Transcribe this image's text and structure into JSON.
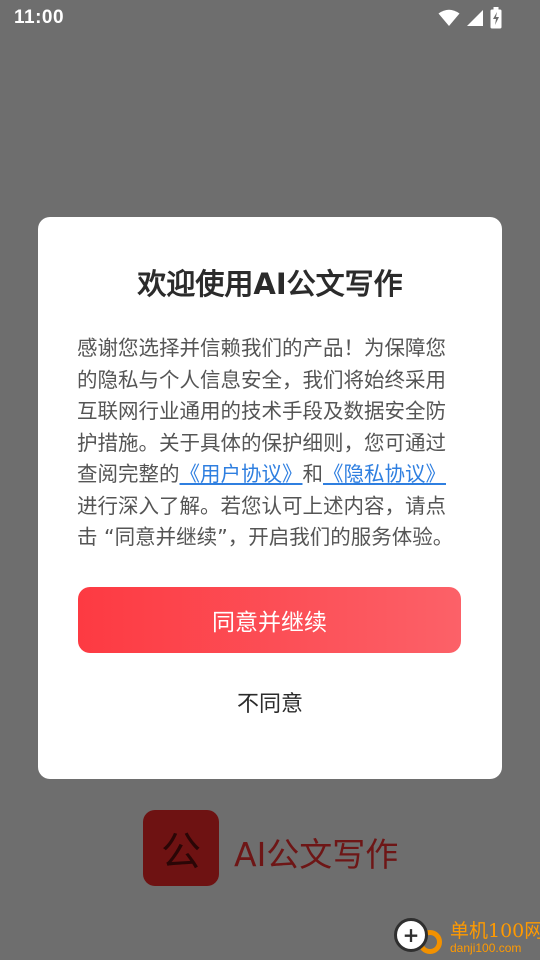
{
  "status_bar": {
    "time": "11:00",
    "icons": [
      "wifi-icon",
      "cell-signal-icon",
      "battery-charging-icon"
    ]
  },
  "dialog": {
    "title": "欢迎使用AI公文写作",
    "body_part1": "感谢您选择并信赖我们的产品！为保障您的隐私与个人信息安全，我们将始终采用互联网行业通用的技术手段及数据安全防护措施。关于具体的保护细则，您可通过查阅完整的",
    "link_user_agreement": "《用户协议》",
    "body_part2": "和",
    "link_privacy_agreement": "《隐私协议》",
    "body_part3": "进行深入了解。若您认可上述内容，请点击 “同意并继续”，开启我们的服务体验。",
    "agree_label": "同意并继续",
    "disagree_label": "不同意"
  },
  "splash": {
    "logo_char": "公",
    "app_name": "AI公文写作"
  },
  "watermark": {
    "brand": "单机100网",
    "url": "danji100.com",
    "logo_glyph": "+"
  },
  "colors": {
    "overlay": "#6e6e6e",
    "accent": "#fd3a42",
    "link": "#2f7fe0",
    "watermark": "#ff9a00"
  }
}
